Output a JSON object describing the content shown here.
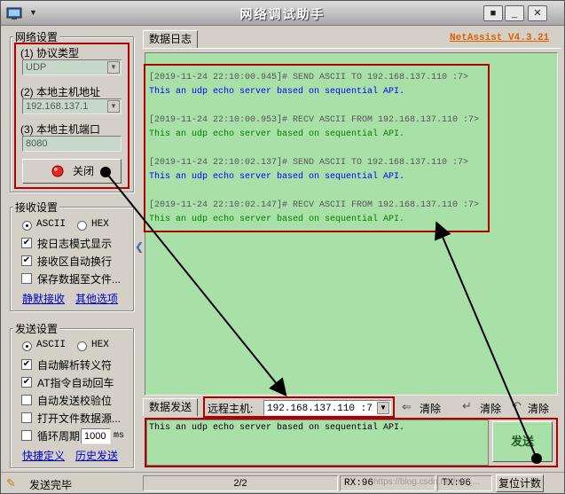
{
  "window": {
    "title": "网络调试助手",
    "version": "NetAssist V4.3.21"
  },
  "network_settings": {
    "title": "网络设置",
    "protocol_label": "(1) 协议类型",
    "protocol_value": "UDP",
    "host_label": "(2) 本地主机地址",
    "host_value": "192.168.137.1",
    "port_label": "(3) 本地主机端口",
    "port_value": "8080",
    "close_button": "关闭"
  },
  "receive_settings": {
    "title": "接收设置",
    "ascii": "ASCII",
    "hex": "HEX",
    "opt1": "按日志模式显示",
    "opt2": "接收区自动换行",
    "opt3": "保存数据至文件...",
    "link1": "静默接收",
    "link2": "其他选项"
  },
  "send_settings": {
    "title": "发送设置",
    "ascii": "ASCII",
    "hex": "HEX",
    "opt1": "自动解析转义符",
    "opt2": "AT指令自动回车",
    "opt3": "自动发送校验位",
    "opt4": "打开文件数据源...",
    "opt5": "循环周期",
    "period_value": "1000",
    "period_unit": "ms",
    "link1": "快捷定义",
    "link2": "历史发送"
  },
  "log": {
    "tab": "数据日志",
    "entries": [
      {
        "header": "[2019-11-24 22:10:00.945]# SEND ASCII TO 192.168.137.110 :7>",
        "body": "This an udp echo server based on sequential API."
      },
      {
        "header": "[2019-11-24 22:10:00.953]# RECV ASCII FROM 192.168.137.110 :7>",
        "body": "This an udp echo server based on sequential API."
      },
      {
        "header": "[2019-11-24 22:10:02.137]# SEND ASCII TO 192.168.137.110 :7>",
        "body": "This an udp echo server based on sequential API."
      },
      {
        "header": "[2019-11-24 22:10:02.147]# RECV ASCII FROM 192.168.137.110 :7>",
        "body": "This an udp echo server based on sequential API."
      }
    ]
  },
  "send_area": {
    "tab": "数据发送",
    "remote_label": "远程主机:",
    "remote_value": "192.168.137.110 :7",
    "clear1": "清除",
    "clear2": "清除",
    "clear3": "清除",
    "text": "This an udp echo server based on sequential API.",
    "send_button": "发送"
  },
  "status": {
    "message": "发送完毕",
    "pages": "2/2",
    "rx": "RX:96",
    "tx": "TX:96",
    "reset": "复位计数",
    "watermark": "https://blog.csdn.net/m0_..."
  },
  "colors": {
    "log_bg": "#a8e0a8",
    "send_text": "#0000ff",
    "recv_text": "#008000",
    "annotation_red": "#b00000",
    "version_orange": "#e06000"
  }
}
